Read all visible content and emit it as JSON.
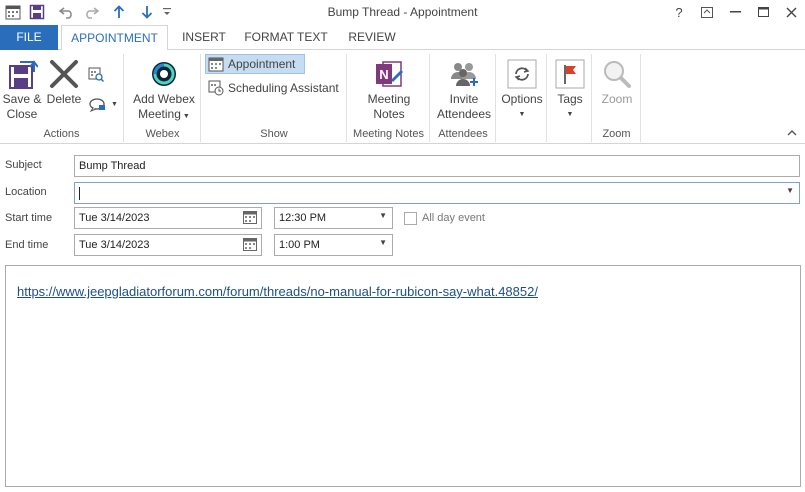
{
  "window": {
    "title": "Bump Thread - Appointment"
  },
  "tabs": {
    "file": "FILE",
    "appointment": "APPOINTMENT",
    "insert": "INSERT",
    "format_text": "FORMAT TEXT",
    "review": "REVIEW"
  },
  "ribbon": {
    "actions": {
      "label": "Actions",
      "save_close_line1": "Save &",
      "save_close_line2": "Close",
      "delete": "Delete"
    },
    "webex": {
      "label": "Webex",
      "add_line1": "Add Webex",
      "add_line2": "Meeting"
    },
    "show": {
      "label": "Show",
      "appointment": "Appointment",
      "scheduling": "Scheduling Assistant"
    },
    "meeting_notes": {
      "label": "Meeting Notes",
      "btn_line1": "Meeting",
      "btn_line2": "Notes"
    },
    "attendees": {
      "label": "Attendees",
      "btn_line1": "Invite",
      "btn_line2": "Attendees"
    },
    "options": {
      "label": "Options"
    },
    "tags": {
      "label": "Tags"
    },
    "zoom": {
      "label": "Zoom",
      "btn": "Zoom"
    }
  },
  "form": {
    "subject_label": "Subject",
    "subject_value": "Bump Thread",
    "location_label": "Location",
    "location_value": "",
    "start_label": "Start time",
    "start_date": "Tue 3/14/2023",
    "start_time": "12:30 PM",
    "all_day_label": "All day event",
    "end_label": "End time",
    "end_date": "Tue 3/14/2023",
    "end_time": "1:00 PM"
  },
  "body": {
    "link": "https://www.jeepgladiatorforum.com/forum/threads/no-manual-for-rubicon-say-what.48852/"
  },
  "colors": {
    "accent": "#2a6ebb",
    "link": "#1f4e8c",
    "onenote": "#80397b"
  }
}
